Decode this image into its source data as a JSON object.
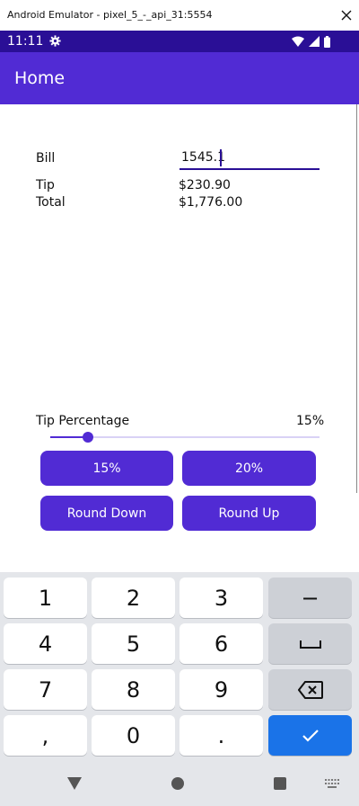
{
  "window": {
    "title": "Android Emulator - pixel_5_-_api_31:5554"
  },
  "status_bar": {
    "time": "11:11"
  },
  "app_bar": {
    "title": "Home"
  },
  "form": {
    "bill_label": "Bill",
    "bill_value": "1545.1",
    "tip_label": "Tip",
    "tip_value": "$230.90",
    "total_label": "Total",
    "total_value": "$1,776.00"
  },
  "tip_slider": {
    "label": "Tip Percentage",
    "value_text": "15%",
    "level_fraction": 0.15
  },
  "buttons": {
    "b15": "15%",
    "b20": "20%",
    "round_down": "Round Down",
    "round_up": "Round Up"
  },
  "keyboard": {
    "k1": "1",
    "k2": "2",
    "k3": "3",
    "minus": "−",
    "k4": "4",
    "k5": "5",
    "k6": "6",
    "k7": "7",
    "k8": "8",
    "k9": "9",
    "comma": ",",
    "k0": "0",
    "period": "."
  },
  "colors": {
    "primary": "#512bd4",
    "status_bar": "#2a0f96",
    "keyboard_bg": "#e4e6ea",
    "done_key": "#1a73e8"
  }
}
